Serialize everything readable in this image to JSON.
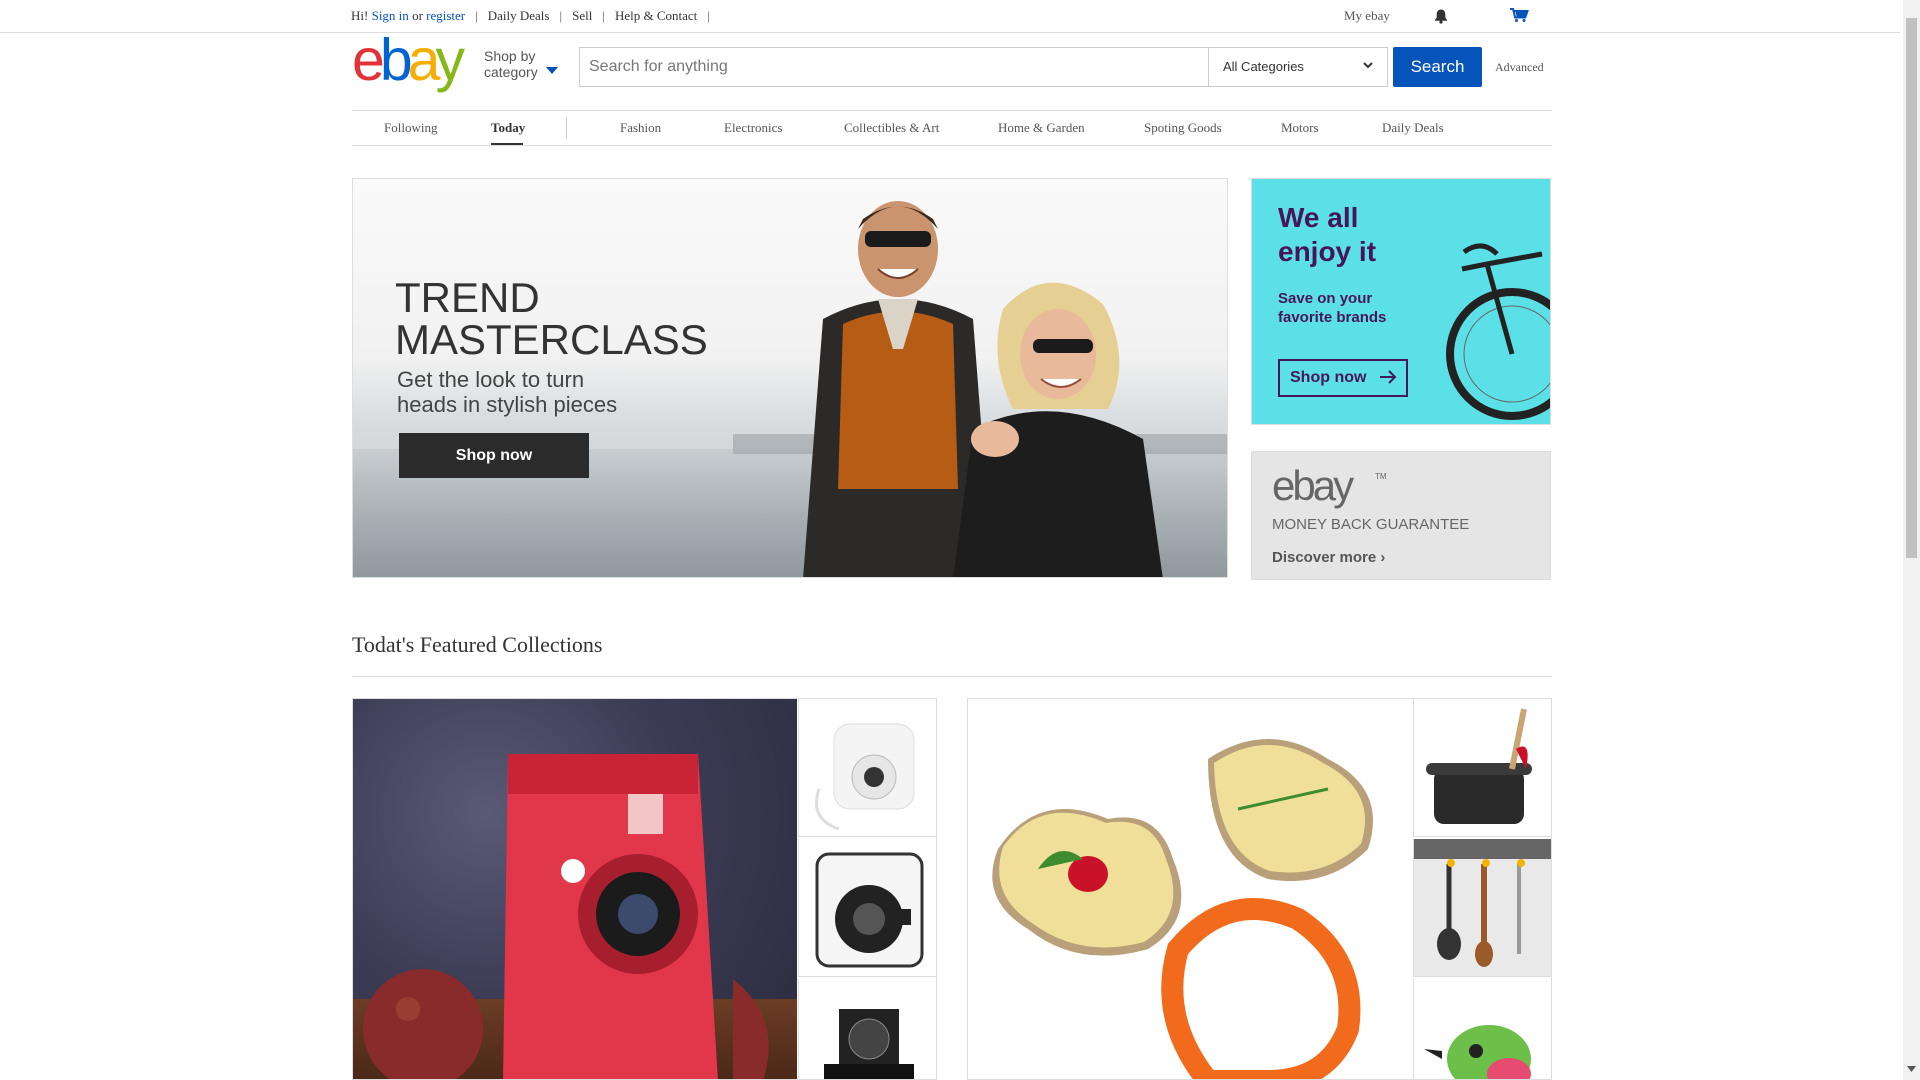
{
  "topbar": {
    "greeting": "Hi!",
    "sign_in": "Sign in",
    "or": "or",
    "register": "register",
    "links": [
      "Daily Deals",
      "Sell",
      "Help & Contact"
    ],
    "my_ebay": "My ebay",
    "bell_icon": "bell-icon",
    "cart_icon": "cart-icon"
  },
  "header": {
    "logo": {
      "e": "e",
      "b": "b",
      "a": "a",
      "y": "y"
    },
    "shop_by": "Shop by",
    "category": "category",
    "search_placeholder": "Search for anything",
    "category_select": "All Categories",
    "search_button": "Search",
    "advanced": "Advanced"
  },
  "nav": {
    "items": [
      "Following",
      "Today",
      "Fashion",
      "Electronics",
      "Collectibles & Art",
      "Home & Garden",
      "Spoting Goods",
      "Motors",
      "Daily Deals"
    ],
    "active": "Today"
  },
  "hero": {
    "title": "TREND\nMASTERCLASS",
    "subtitle": "Get the look to turn\nheads in stylish pieces",
    "cta": "Shop now"
  },
  "side_ad_1": {
    "title": "We all\nenjoy it",
    "subtitle": "Save on your\nfavorite brands",
    "cta": "Shop now",
    "colors": {
      "bg": "#5be0e7",
      "text": "#47165a"
    }
  },
  "side_ad_2": {
    "logo": "ebay",
    "tm": "TM",
    "guarantee": "MONEY BACK GUARANTEE",
    "discover": "Discover more ›"
  },
  "featured": {
    "title": "Todat's Featured Collections"
  },
  "colors": {
    "link": "#0654ba",
    "search_button": "#0654ba",
    "logo_e": "#e53238",
    "logo_b": "#0064d2",
    "logo_a": "#f5af02",
    "logo_y": "#86b817"
  }
}
